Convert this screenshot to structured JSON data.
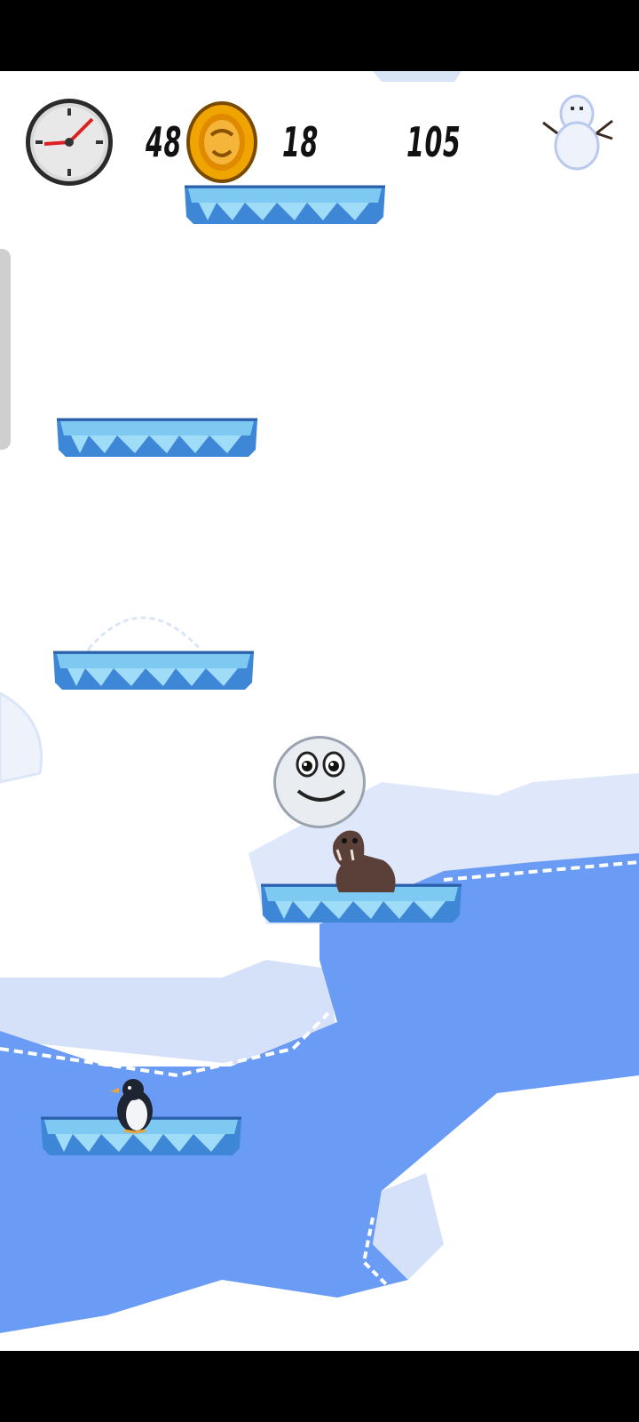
{
  "hud": {
    "time": "48",
    "coins": "18",
    "score": "105",
    "timer_icon": "clock-icon",
    "coin_icon": "coin-icon",
    "pause_icon": "snowman-icon"
  },
  "scene": {
    "platform_count": 5,
    "characters": [
      "snowball",
      "walrus",
      "penguin"
    ]
  },
  "colors": {
    "water": "#6b9cf5",
    "ice": "#cfe0fb",
    "platform_top": "#7dc9f2",
    "platform_bottom": "#3e86d6"
  }
}
